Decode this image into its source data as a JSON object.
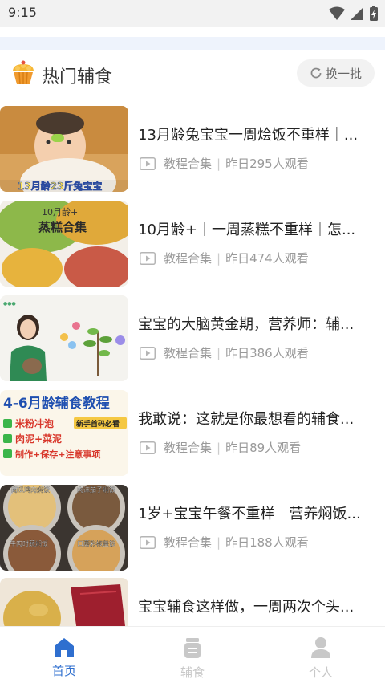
{
  "status_bar": {
    "time": "9:15"
  },
  "header": {
    "title": "热门辅食",
    "refresh_label": "换一批"
  },
  "items": [
    {
      "title": "13月龄兔宝宝一周烩饭不重样｜...",
      "category": "教程合集",
      "views": "昨日295人观看"
    },
    {
      "title": "10月龄+｜一周蒸糕不重样｜怎...",
      "category": "教程合集",
      "views": "昨日474人观看"
    },
    {
      "title": "宝宝的大脑黄金期，营养师：辅...",
      "category": "教程合集",
      "views": "昨日386人观看"
    },
    {
      "title": "我敢说：这就是你最想看的辅食...",
      "category": "教程合集",
      "views": "昨日89人观看"
    },
    {
      "title": "1岁+宝宝午餐不重样｜营养焖饭...",
      "category": "教程合集",
      "views": "昨日188人观看"
    },
    {
      "title": "宝宝辅食这样做，一周两次个头...",
      "category": "教程合集",
      "views": ""
    }
  ],
  "thumb_texts": {
    "t1": "13月龄23斤兔宝宝",
    "t2a": "10月龄+",
    "t2b": "蒸糕合集",
    "t4a": "4-6月龄辅食教程",
    "t4b": "米粉冲泡",
    "t4c": "肉泥+菜泥",
    "t4d": "制作+保存+注意事项",
    "t4e": "新手首码必看",
    "t5a": "南瓜鸡肉焖饭",
    "t5b": "肉沫茄子焖饭",
    "t5c": "牛肉时蔬焖饭",
    "t5d": "口蘑彩椒盖饭"
  },
  "nav": [
    {
      "label": "首页",
      "icon": "home-icon",
      "active": true
    },
    {
      "label": "辅食",
      "icon": "baby-food-jar-icon",
      "active": false
    },
    {
      "label": "个人",
      "icon": "person-icon",
      "active": false
    }
  ],
  "colors": {
    "accent": "#2f6fcf",
    "inactive": "#c8c8c8",
    "meta": "#9a9a9a"
  }
}
